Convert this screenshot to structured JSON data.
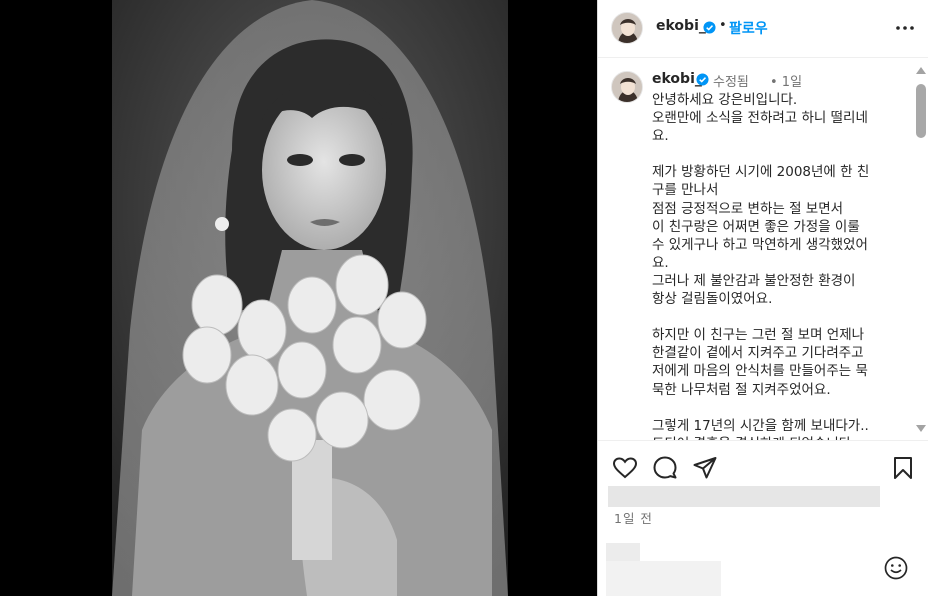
{
  "post": {
    "username": "ekobi_",
    "follow_label": "팔로우",
    "separator": "•",
    "edited_label": "수정됨",
    "ago": "• 1일",
    "caption": "안녕하세요 강은비입니다.\n오랜만에 소식을 전하려고 하니 떨리네\n요.\n\n제가 방황하던 시기에 2008년에 한 친\n구를 만나서\n점점 긍정적으로 변하는 절 보면서\n이 친구랑은 어쩌면 좋은 가정을 이룰\n수 있게구나 하고 막연하게 생각했었어\n요.\n그러나 제 불안감과 불안정한 환경이\n항상 걸림돌이였어요.\n\n하지만 이 친구는 그런 절 보며 언제나\n한결같이 곁에서 지켜주고 기다려주고\n저에게 마음의 안식처를 만들어주는 묵\n묵한 나무처럼 절 지켜주었어요.\n\n그렇게 17년의 시간을 함께 보내다가..\n드디어 결혼을 결심하게 되었습니다.",
    "time_small": "1일 전"
  },
  "icons": {
    "verified": "verified-badge-icon",
    "more": "more-options-icon",
    "like": "heart-icon",
    "comment": "comment-icon",
    "share": "share-icon",
    "save": "bookmark-icon",
    "emoji": "emoji-icon"
  },
  "colors": {
    "accent": "#0095f6",
    "text": "#262626",
    "muted": "#737373"
  }
}
